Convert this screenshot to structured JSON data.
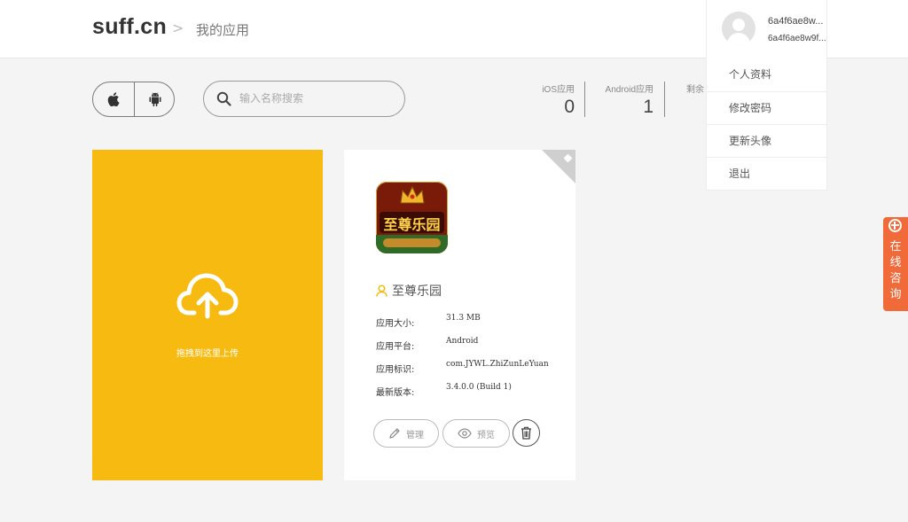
{
  "header": {
    "logo": "suff.cn",
    "breadcrumb_sep": ">",
    "breadcrumb": "我的应用"
  },
  "user": {
    "name_line1": "6a4f6ae8w...",
    "name_line2": "6a4f6ae8w9f..."
  },
  "user_menu": {
    "items": [
      {
        "label": "个人资料"
      },
      {
        "label": "修改密码"
      },
      {
        "label": "更新头像"
      },
      {
        "label": "退出"
      }
    ]
  },
  "toolbar": {
    "platforms": [
      "apple-icon",
      "android-icon"
    ],
    "search_placeholder": "输入名称搜索"
  },
  "stats": {
    "ios_label": "iOS应用",
    "ios_value": "0",
    "android_label": "Android应用",
    "android_value": "1",
    "remaining_label": "剩余"
  },
  "upload": {
    "text": "拖拽到这里上传"
  },
  "app": {
    "icon_text": "至尊乐园",
    "name": "至尊乐园",
    "fields": [
      {
        "key": "应用大小:",
        "value": "31.3 MB"
      },
      {
        "key": "应用平台:",
        "value": "Android"
      },
      {
        "key": "应用标识:",
        "value": "com.JYWL.ZhiZunLeYuan"
      },
      {
        "key": "最新版本:",
        "value": "3.4.0.0 (Build 1)"
      }
    ],
    "manage_label": "管理",
    "preview_label": "预览"
  },
  "consult": {
    "text": "在线咨询"
  },
  "colors": {
    "upload_bg": "#f6ba10",
    "consult_bg": "#f06a3a",
    "page_bg": "#f4f4f4"
  }
}
